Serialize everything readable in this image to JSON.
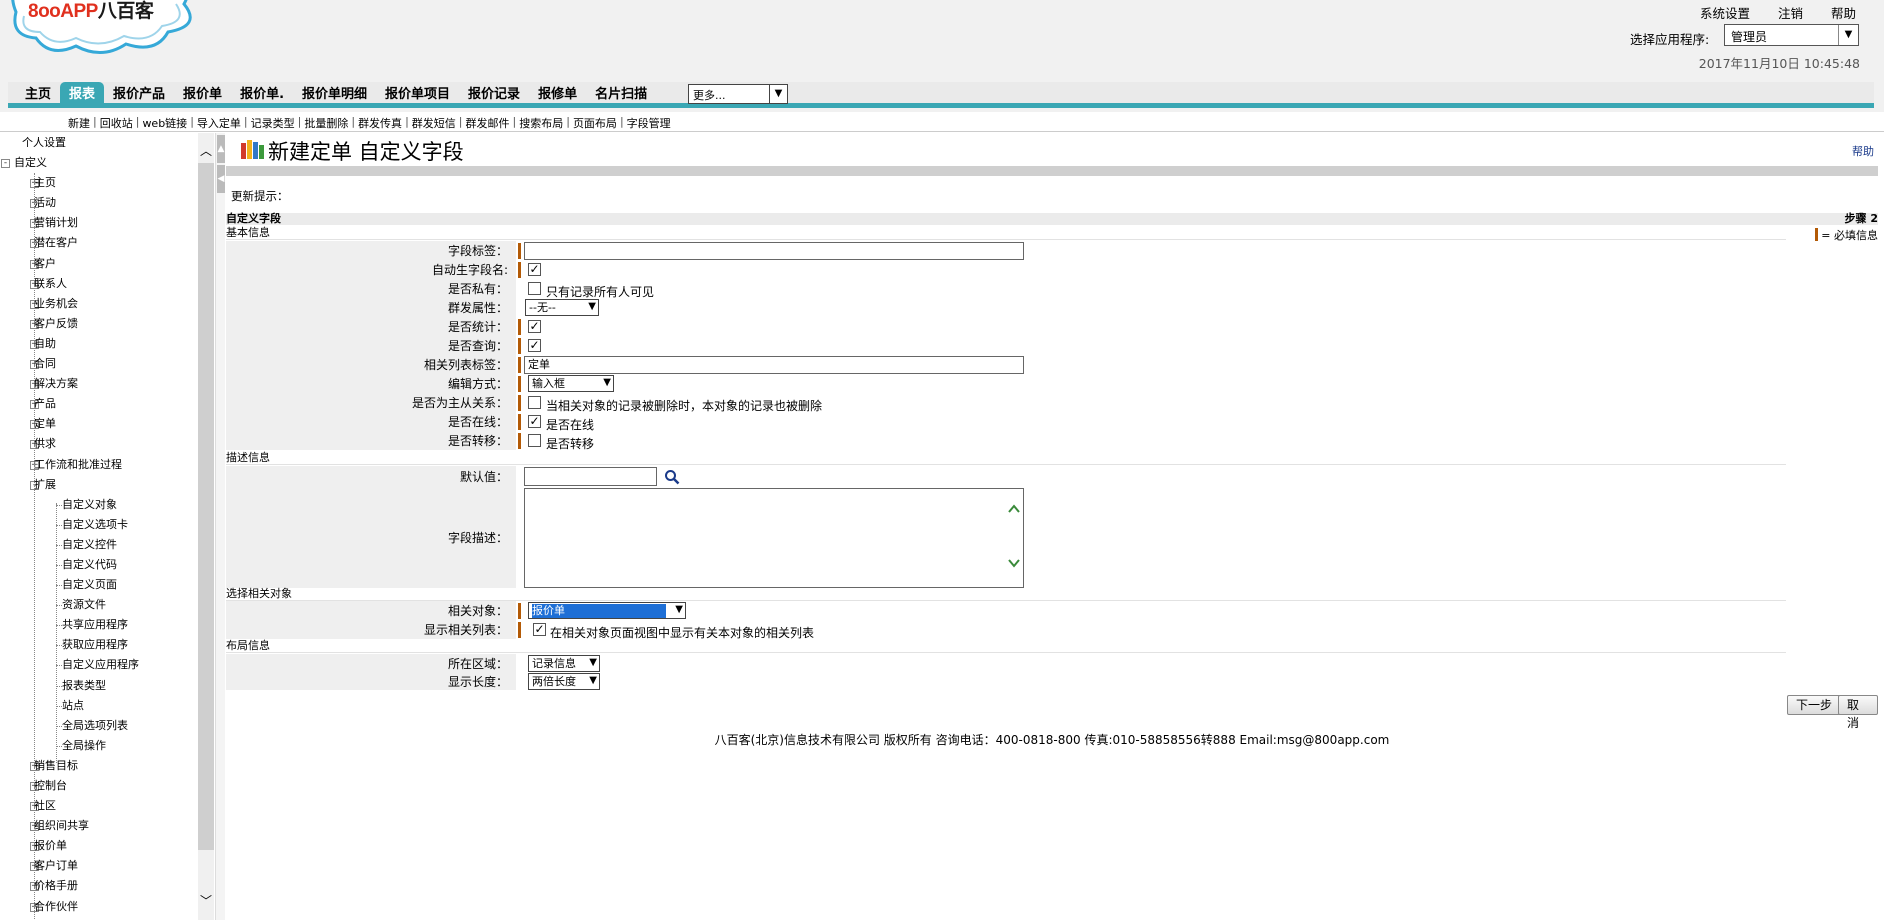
{
  "header": {
    "logo_text": "8ooAPP",
    "logo_cn": "八百客",
    "top_links": [
      "系统设置",
      "注销",
      "帮助"
    ],
    "app_select_label": "选择应用程序:",
    "app_select_value": "管理员",
    "datetime": "2017年11月10日 10:45:48"
  },
  "nav": {
    "tabs": [
      "主页",
      "报表",
      "报价产品",
      "报价单",
      "报价单.",
      "报价单明细",
      "报价单项目",
      "报价记录",
      "报修单",
      "名片扫描"
    ],
    "active_tab": "报表",
    "more_select": "更多..."
  },
  "subnav": [
    "新建",
    "回收站",
    "web链接",
    "导入定单",
    "记录类型",
    "批量删除",
    "群发传真",
    "群发短信",
    "群发邮件",
    "搜索布局",
    "页面布局",
    "字段管理"
  ],
  "sidebar": {
    "items": [
      {
        "label": "个人设置",
        "level": 0
      },
      {
        "label": "自定义",
        "level": 1,
        "expander": "-"
      },
      {
        "label": "主页",
        "level": 2,
        "expander": "+"
      },
      {
        "label": "活动",
        "level": 2,
        "expander": "+"
      },
      {
        "label": "营销计划",
        "level": 2,
        "expander": "+"
      },
      {
        "label": "潜在客户",
        "level": 2,
        "expander": "+"
      },
      {
        "label": "客户",
        "level": 2,
        "expander": "+"
      },
      {
        "label": "联系人",
        "level": 2,
        "expander": "+"
      },
      {
        "label": "业务机会",
        "level": 2,
        "expander": "+"
      },
      {
        "label": "客户反馈",
        "level": 2,
        "expander": "+"
      },
      {
        "label": "自助",
        "level": 2,
        "expander": "+"
      },
      {
        "label": "合同",
        "level": 2,
        "expander": "+"
      },
      {
        "label": "解决方案",
        "level": 2,
        "expander": "+"
      },
      {
        "label": "产品",
        "level": 2,
        "expander": "+"
      },
      {
        "label": "定单",
        "level": 2,
        "expander": "+"
      },
      {
        "label": "供求",
        "level": 2,
        "expander": "+"
      },
      {
        "label": "工作流和批准过程",
        "level": 2,
        "expander": "+"
      },
      {
        "label": "扩展",
        "level": 2,
        "expander": "-"
      },
      {
        "label": "自定义对象",
        "level": 3
      },
      {
        "label": "自定义选项卡",
        "level": 3
      },
      {
        "label": "自定义控件",
        "level": 3
      },
      {
        "label": "自定义代码",
        "level": 3
      },
      {
        "label": "自定义页面",
        "level": 3
      },
      {
        "label": "资源文件",
        "level": 3
      },
      {
        "label": "共享应用程序",
        "level": 3
      },
      {
        "label": "获取应用程序",
        "level": 3
      },
      {
        "label": "自定义应用程序",
        "level": 3
      },
      {
        "label": "报表类型",
        "level": 3
      },
      {
        "label": "站点",
        "level": 3
      },
      {
        "label": "全局选项列表",
        "level": 3
      },
      {
        "label": "全局操作",
        "level": 3
      },
      {
        "label": "销售目标",
        "level": 2,
        "expander": "+"
      },
      {
        "label": "控制台",
        "level": 2,
        "expander": "+"
      },
      {
        "label": "社区",
        "level": 2,
        "expander": "+"
      },
      {
        "label": "组织间共享",
        "level": 2,
        "expander": "+"
      },
      {
        "label": "报价单",
        "level": 2,
        "expander": "+"
      },
      {
        "label": "客户订单",
        "level": 2,
        "expander": "+"
      },
      {
        "label": "价格手册",
        "level": 2,
        "expander": "+"
      },
      {
        "label": "合作伙伴",
        "level": 2,
        "expander": "+"
      }
    ]
  },
  "main": {
    "title": "新建定单 自定义字段",
    "help": "帮助",
    "update_tip": "更新提示：",
    "custom_field_header": "自定义字段",
    "step": "步骤 2",
    "required_legend": "= 必填信息",
    "sections": {
      "basic": "基本信息",
      "desc": "描述信息",
      "related": "选择相关对象",
      "layout": "布局信息"
    },
    "fields": {
      "field_label": {
        "label": "字段标签：",
        "value": ""
      },
      "auto_name": {
        "label": "自动生字段名:"
      },
      "is_private": {
        "label": "是否私有：",
        "option": "只有记录所有人可见"
      },
      "mass_attr": {
        "label": "群发属性：",
        "value": "--无--"
      },
      "is_stat": {
        "label": "是否统计："
      },
      "is_query": {
        "label": "是否查询："
      },
      "related_list_label": {
        "label": "相关列表标签：",
        "value": "定单"
      },
      "edit_mode": {
        "label": "编辑方式：",
        "value": "输入框"
      },
      "master_detail": {
        "label": "是否为主从关系：",
        "option": "当相关对象的记录被删除时，本对象的记录也被删除"
      },
      "is_online": {
        "label": "是否在线：",
        "option": "是否在线"
      },
      "is_transfer": {
        "label": "是否转移：",
        "option": "是否转移"
      },
      "default_value": {
        "label": "默认值：",
        "value": ""
      },
      "field_desc": {
        "label": "字段描述：",
        "value": ""
      },
      "related_object": {
        "label": "相关对象：",
        "value": "报价单"
      },
      "show_related_list": {
        "label": "显示相关列表：",
        "option": "在相关对象页面视图中显示有关本对象的相关列表"
      },
      "area": {
        "label": "所在区域：",
        "value": "记录信息"
      },
      "display_length": {
        "label": "显示长度：",
        "value": "两倍长度"
      }
    },
    "buttons": {
      "next": "下一步",
      "cancel": "取消"
    },
    "footer": "八百客(北京)信息技术有限公司 版权所有 咨询电话：400-0818-800 传真:010-58858556转888 Email:msg@800app.com"
  },
  "colors": {
    "accent": "#3aa7b4",
    "required": "#b35a06"
  }
}
